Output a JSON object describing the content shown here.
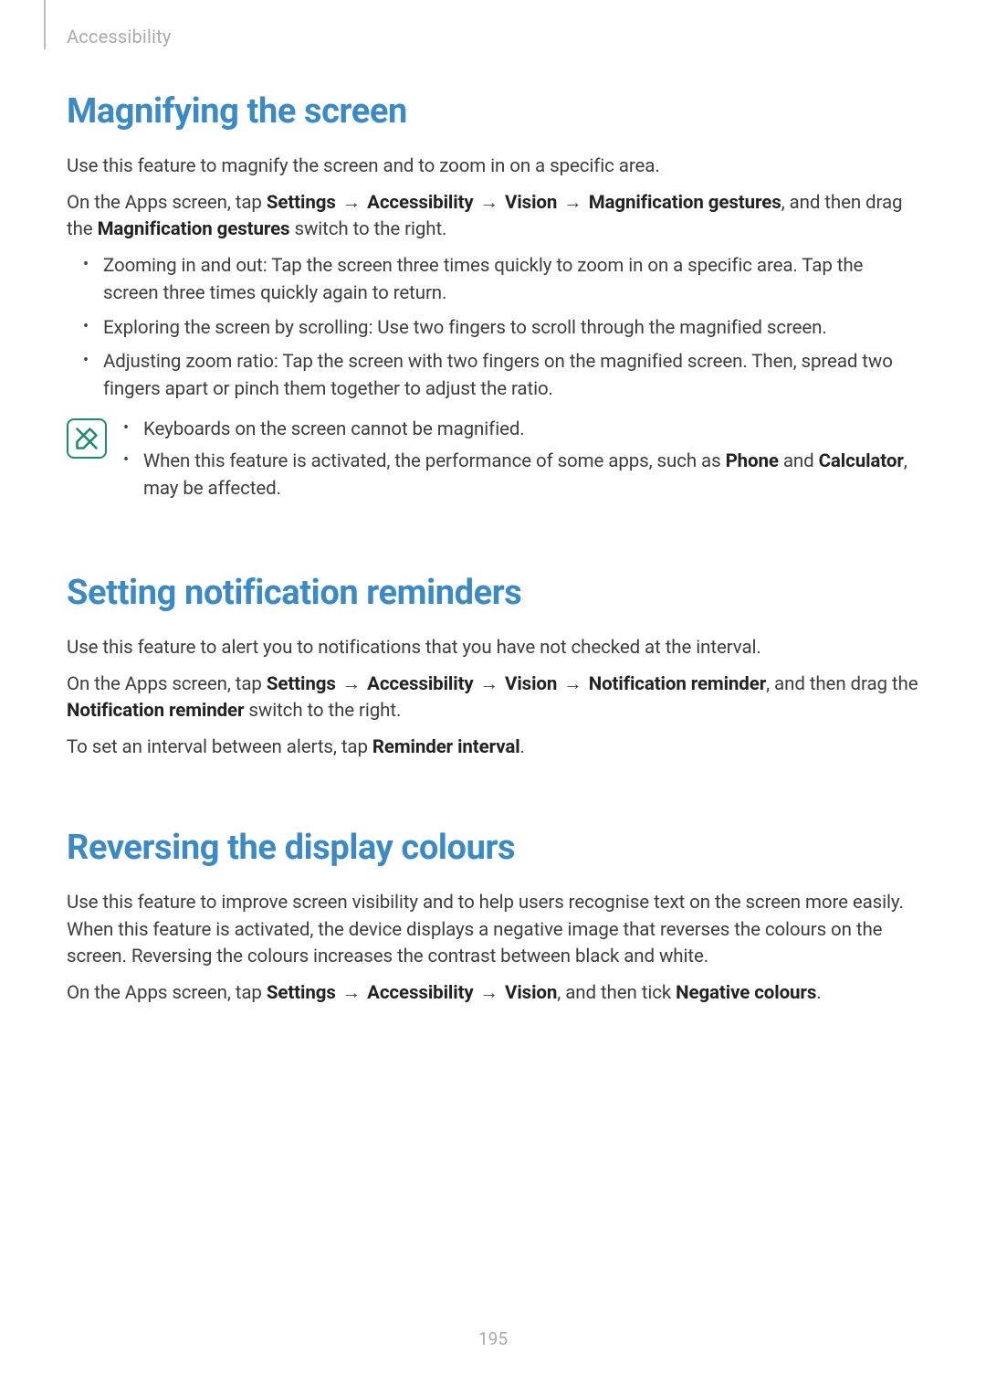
{
  "breadcrumb": "Accessibility",
  "page_number": "195",
  "arrow": "→",
  "sections": {
    "magnify": {
      "heading": "Magnifying the screen",
      "intro": "Use this feature to magnify the screen and to zoom in on a specific area.",
      "nav_pre": "On the Apps screen, tap ",
      "nav_b1": "Settings",
      "nav_b2": "Accessibility",
      "nav_b3": "Vision",
      "nav_b4": "Magnification gestures",
      "nav_mid": ", and then drag the ",
      "nav_b5": "Magnification gestures",
      "nav_post": " switch to the right.",
      "bullets": [
        "Zooming in and out: Tap the screen three times quickly to zoom in on a specific area. Tap the screen three times quickly again to return.",
        "Exploring the screen by scrolling: Use two fingers to scroll through the magnified screen.",
        "Adjusting zoom ratio: Tap the screen with two fingers on the magnified screen. Then, spread two fingers apart or pinch them together to adjust the ratio."
      ],
      "note": {
        "b1": "Keyboards on the screen cannot be magnified.",
        "b2_pre": "When this feature is activated, the performance of some apps, such as ",
        "b2_bold1": "Phone",
        "b2_and": " and ",
        "b2_bold2": "Calculator",
        "b2_post": ", may be affected."
      }
    },
    "reminders": {
      "heading": "Setting notification reminders",
      "intro": "Use this feature to alert you to notifications that you have not checked at the interval.",
      "nav_pre": "On the Apps screen, tap ",
      "nav_b1": "Settings",
      "nav_b2": "Accessibility",
      "nav_b3": "Vision",
      "nav_b4": "Notification reminder",
      "nav_mid": ", and then drag the ",
      "nav_b5": "Notification reminder",
      "nav_post": " switch to the right.",
      "interval_pre": "To set an interval between alerts, tap ",
      "interval_bold": "Reminder interval",
      "interval_post": "."
    },
    "reverse": {
      "heading": "Reversing the display colours",
      "intro": "Use this feature to improve screen visibility and to help users recognise text on the screen more easily. When this feature is activated, the device displays a negative image that reverses the colours on the screen. Reversing the colours increases the contrast between black and white.",
      "nav_pre": "On the Apps screen, tap ",
      "nav_b1": "Settings",
      "nav_b2": "Accessibility",
      "nav_b3": "Vision",
      "nav_mid": ", and then tick ",
      "nav_b4": "Negative colours",
      "nav_post": "."
    }
  }
}
